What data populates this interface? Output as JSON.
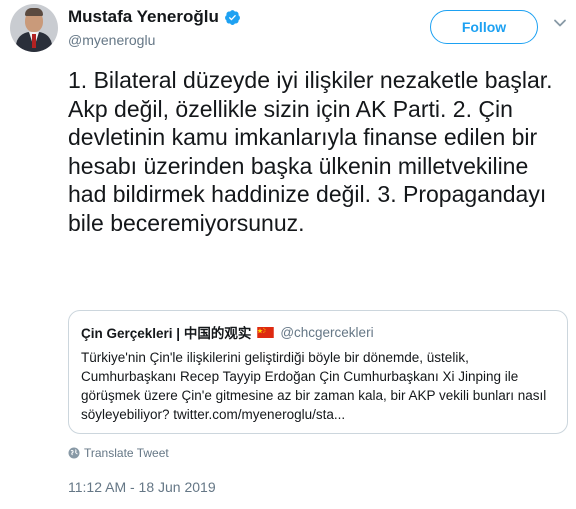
{
  "author": {
    "display_name": "Mustafa Yeneroğlu",
    "handle": "@myeneroglu"
  },
  "follow_label": "Follow",
  "tweet_text": "1. Bilateral düzeyde iyi ilişkiler nezaketle başlar. Akp değil, özellikle sizin için AK Parti. 2. Çin devletinin kamu imkanlarıyla finanse edilen bir hesabı üzerinden başka ülkenin milletvekiline had bildirmek haddinize değil. 3. Propagandayı bile beceremiyorsunuz.",
  "quoted": {
    "name": "Çin Gerçekleri | 中国的观实",
    "handle": "@chcgercekleri",
    "text": "Türkiye'nin Çin'le ilişkilerini geliştirdiği böyle bir dönemde, üstelik, Cumhurbaşkanı Recep Tayyip Erdoğan Çin Cumhurbaşkanı Xi Jinping ile görüşmek üzere Çin'e gitmesine az bir zaman kala, bir AKP vekili bunları nasıl söyleyebiliyor? twitter.com/myeneroglu/sta..."
  },
  "translate_label": "Translate Tweet",
  "timestamp": "11:12 AM - 18 Jun 2019",
  "icons": {
    "verified": "verified-badge-icon",
    "flag": "china-flag-icon",
    "translate": "globe-icon",
    "caret": "chevron-down-icon"
  },
  "colors": {
    "accent": "#1da1f2",
    "text": "#14171a",
    "muted": "#657786",
    "border": "#ccd6dd"
  }
}
